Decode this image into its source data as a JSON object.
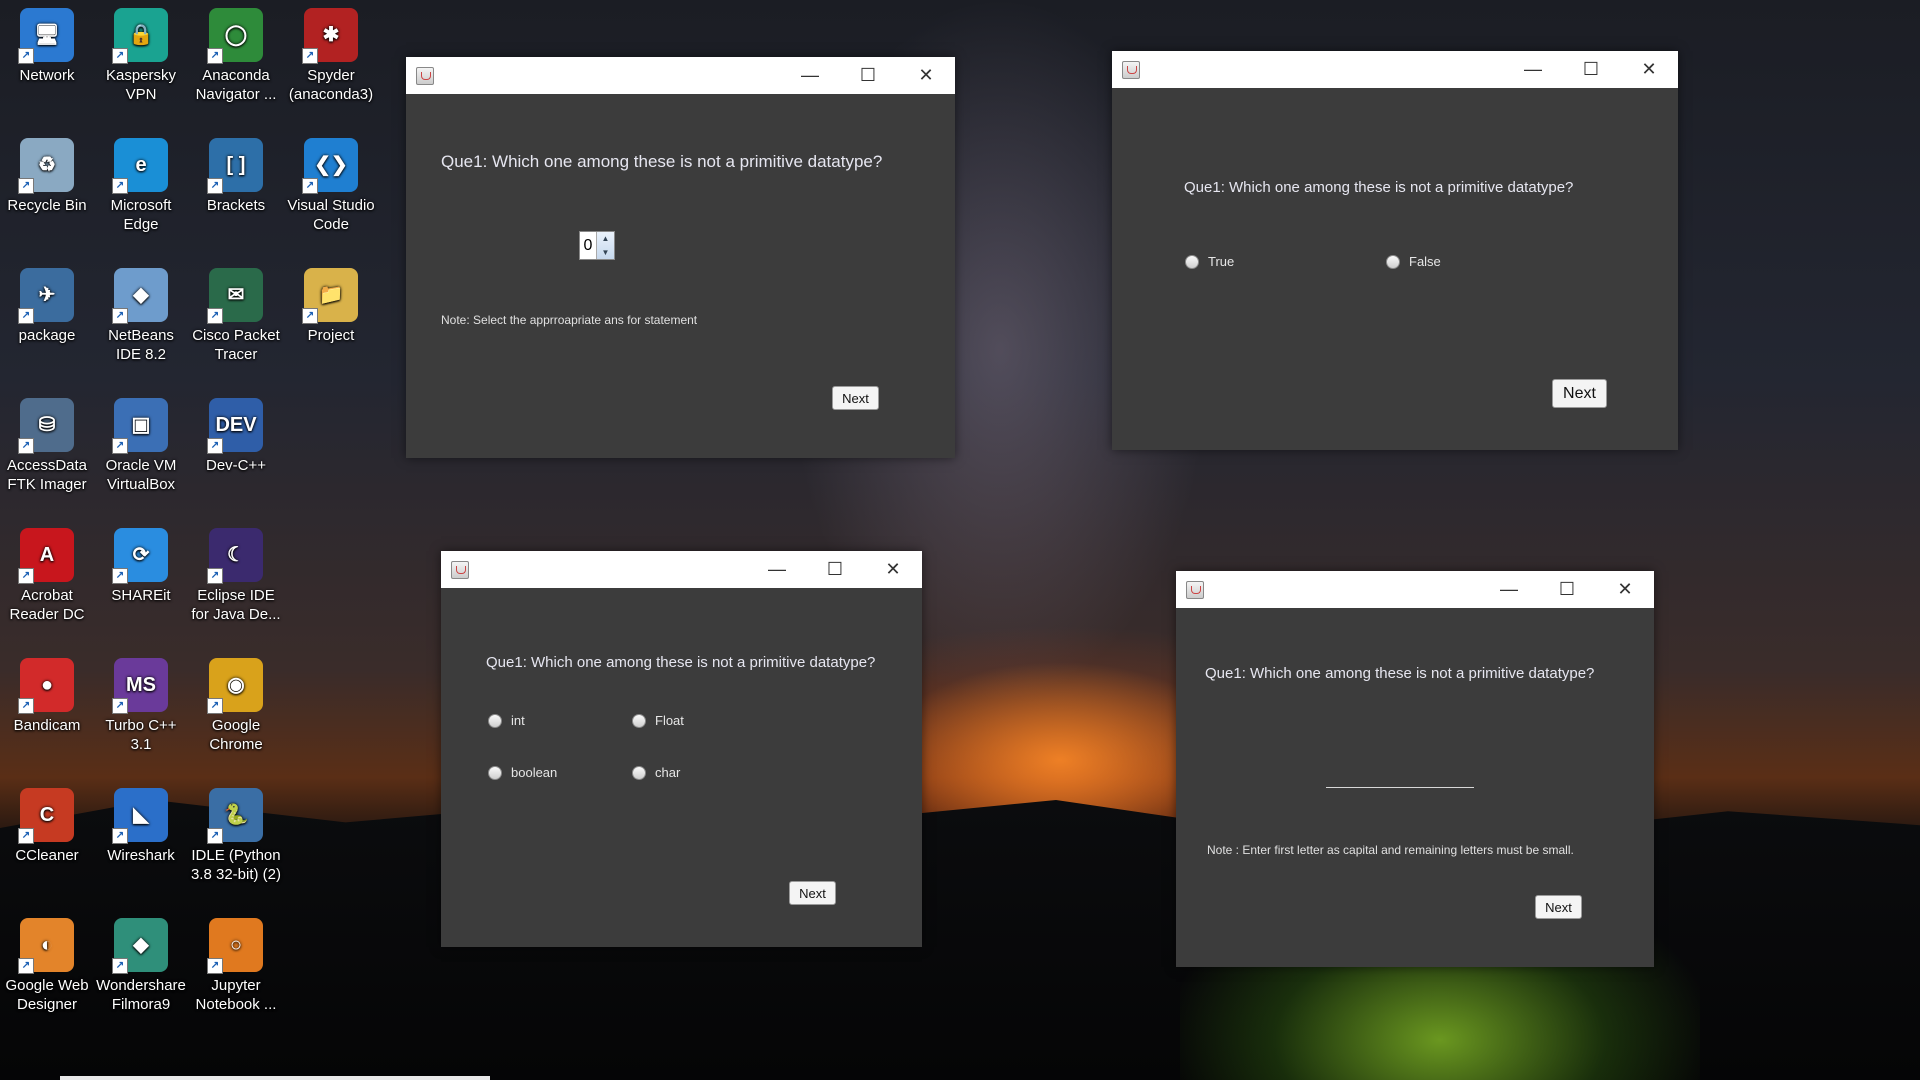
{
  "desktop": {
    "icons": [
      {
        "label": "Network",
        "color": "#2b79d1",
        "glyph": "🖥"
      },
      {
        "label": "Kaspersky VPN",
        "color": "#1aa391",
        "glyph": "🔒"
      },
      {
        "label": "Anaconda Navigator ...",
        "color": "#2e8b3a",
        "glyph": "◯"
      },
      {
        "label": "Spyder (anaconda3)",
        "color": "#b22222",
        "glyph": "✱"
      },
      {
        "label": "Recycle Bin",
        "color": "#8aa9c2",
        "glyph": "♻"
      },
      {
        "label": "Microsoft Edge",
        "color": "#1a8fd6",
        "glyph": "e"
      },
      {
        "label": "Brackets",
        "color": "#2d6fa8",
        "glyph": "[ ]"
      },
      {
        "label": "Visual Studio Code",
        "color": "#1f7fd1",
        "glyph": "❮❯"
      },
      {
        "label": "package",
        "color": "#3b6c9e",
        "glyph": "✈"
      },
      {
        "label": "NetBeans IDE 8.2",
        "color": "#6e9ccc",
        "glyph": "◆"
      },
      {
        "label": "Cisco Packet Tracer",
        "color": "#2a6a4a",
        "glyph": "✉"
      },
      {
        "label": "Project",
        "color": "#d9b24a",
        "glyph": "📁"
      },
      {
        "label": "AccessData FTK Imager",
        "color": "#4f6c8c",
        "glyph": "⛁"
      },
      {
        "label": "Oracle VM VirtualBox",
        "color": "#3b6fb5",
        "glyph": "▣"
      },
      {
        "label": "Dev-C++",
        "color": "#2f5ea8",
        "glyph": "DEV"
      },
      {
        "label": "Acrobat Reader DC",
        "color": "#c8161d",
        "glyph": "A"
      },
      {
        "label": "SHAREit",
        "color": "#2a8de0",
        "glyph": "⟳"
      },
      {
        "label": "Eclipse IDE for Java De...",
        "color": "#3b2a6e",
        "glyph": "☾"
      },
      {
        "label": "Bandicam",
        "color": "#d22a2a",
        "glyph": "●"
      },
      {
        "label": "Turbo C++ 3.1",
        "color": "#6a3a9a",
        "glyph": "MS"
      },
      {
        "label": "Google Chrome",
        "color": "#d9a21b",
        "glyph": "◉"
      },
      {
        "label": "CCleaner",
        "color": "#c63a22",
        "glyph": "C"
      },
      {
        "label": "Wireshark",
        "color": "#2b6fc9",
        "glyph": "◣"
      },
      {
        "label": "IDLE (Python 3.8 32-bit) (2)",
        "color": "#3a6ea5",
        "glyph": "🐍"
      },
      {
        "label": "Google Web Designer",
        "color": "#e3842a",
        "glyph": "◐"
      },
      {
        "label": "Wondershare Filmora9",
        "color": "#2f8f7a",
        "glyph": "◆"
      },
      {
        "label": "Jupyter Notebook ...",
        "color": "#e0791f",
        "glyph": "○"
      }
    ]
  },
  "windows": {
    "spinner": {
      "question": "Que1: Which one among these is not a primitive datatype?",
      "spinner_value": "0",
      "note": "Note: Select the apprroapriate ans for statement",
      "next_label": "Next"
    },
    "true_false": {
      "question": "Que1: Which one among these is not a primitive datatype?",
      "options": [
        "True",
        "False"
      ],
      "next_label": "Next"
    },
    "multiple_choice": {
      "question": "Que1: Which one among these is not a primitive datatype?",
      "options": [
        "int",
        "Float",
        "boolean",
        "char"
      ],
      "next_label": "Next"
    },
    "text_entry": {
      "question": "Que1: Which one among these is not a primitive datatype?",
      "note": "Note : Enter first letter as capital and remaining letters must be small.",
      "next_label": "Next"
    }
  },
  "window_controls": {
    "minimize": "—",
    "maximize": "☐",
    "close": "✕"
  }
}
